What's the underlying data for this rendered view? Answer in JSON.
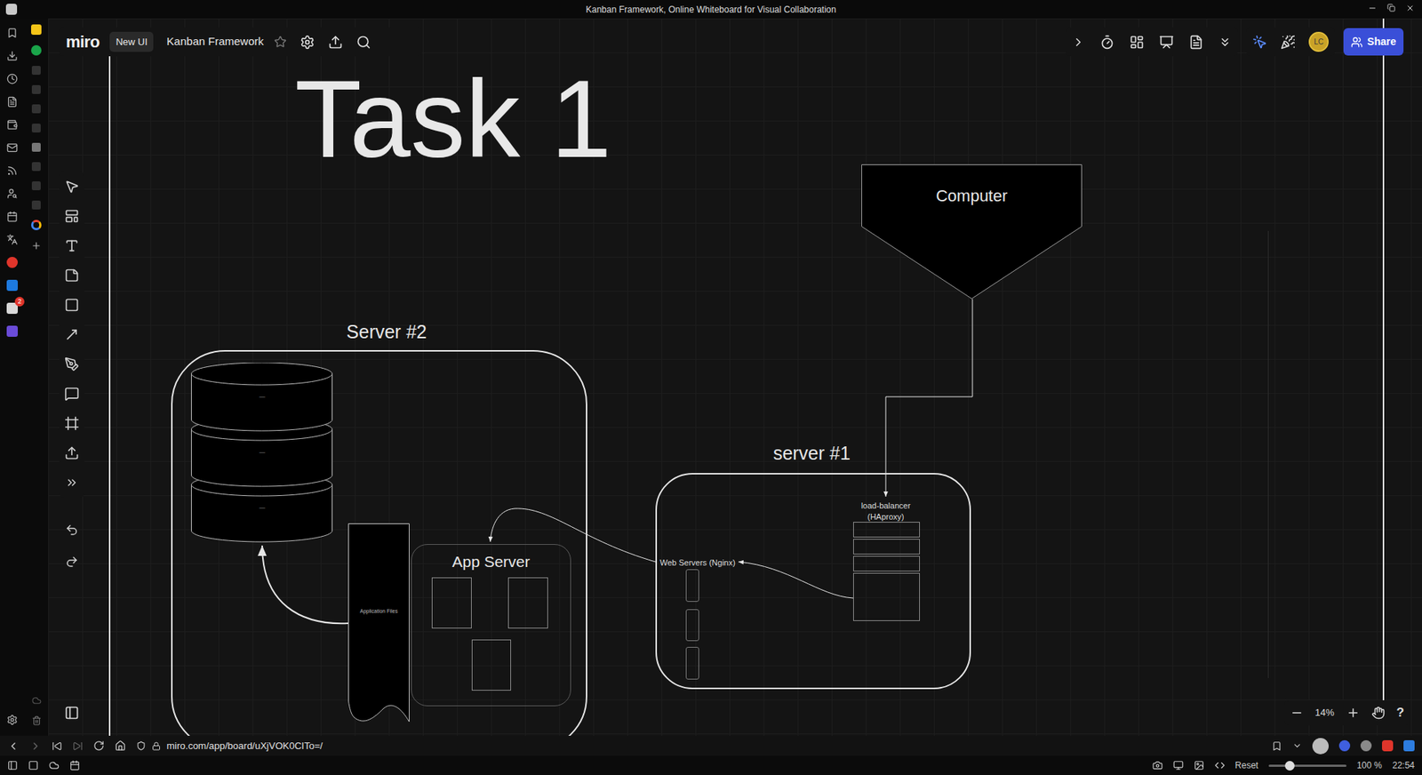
{
  "window": {
    "title": "Kanban Framework, Online Whiteboard for Visual Collaboration"
  },
  "sidebar": {
    "badge": "2"
  },
  "toolbar": {
    "logo": "miro",
    "badge": "New UI",
    "board_name": "Kanban Framework",
    "starred": false,
    "avatar": "LC",
    "share": "Share"
  },
  "canvas": {
    "frame_title": "Task 1",
    "computer": "Computer",
    "server2": {
      "label": "Server #2",
      "db_discs": [
        "—",
        "—",
        "—"
      ],
      "files": "Application Files",
      "app_server": "App Server"
    },
    "server1": {
      "label": "server #1",
      "load_balancer": [
        "load-balancer",
        "(HAproxy)"
      ],
      "web_servers": "Web Servers (Nginx)"
    }
  },
  "zoom": {
    "level": "14%",
    "help": "?"
  },
  "address_bar": {
    "url": "miro.com/app/board/uXjVOK0CITo=/"
  },
  "status_bar": {
    "reset": "Reset",
    "zoom": "100 %",
    "time": "22:54"
  }
}
